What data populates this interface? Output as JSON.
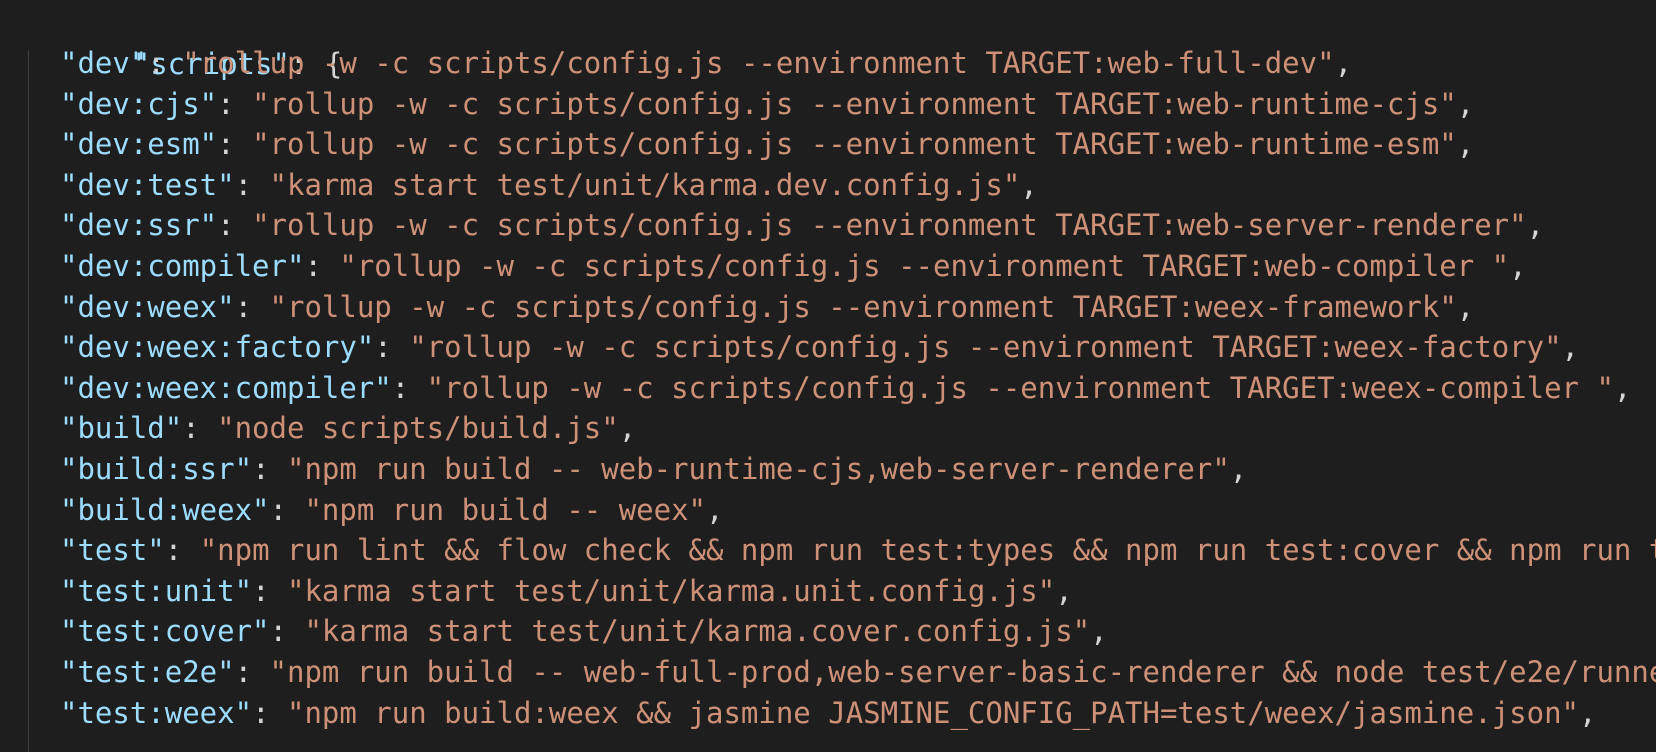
{
  "editor": {
    "language": "json",
    "colors": {
      "background": "#1e1e1e",
      "key": "#9cdcfe",
      "string": "#ce9178",
      "punctuation": "#d4d4d4"
    },
    "root_key": "\"scripts\"",
    "root_open": ": {",
    "entries": [
      {
        "key": "\"dev\"",
        "value": "\"rollup -w -c scripts/config.js --environment TARGET:web-full-dev\"",
        "trail": ","
      },
      {
        "key": "\"dev:cjs\"",
        "value": "\"rollup -w -c scripts/config.js --environment TARGET:web-runtime-cjs\"",
        "trail": ","
      },
      {
        "key": "\"dev:esm\"",
        "value": "\"rollup -w -c scripts/config.js --environment TARGET:web-runtime-esm\"",
        "trail": ","
      },
      {
        "key": "\"dev:test\"",
        "value": "\"karma start test/unit/karma.dev.config.js\"",
        "trail": ","
      },
      {
        "key": "\"dev:ssr\"",
        "value": "\"rollup -w -c scripts/config.js --environment TARGET:web-server-renderer\"",
        "trail": ","
      },
      {
        "key": "\"dev:compiler\"",
        "value": "\"rollup -w -c scripts/config.js --environment TARGET:web-compiler \"",
        "trail": ","
      },
      {
        "key": "\"dev:weex\"",
        "value": "\"rollup -w -c scripts/config.js --environment TARGET:weex-framework\"",
        "trail": ","
      },
      {
        "key": "\"dev:weex:factory\"",
        "value": "\"rollup -w -c scripts/config.js --environment TARGET:weex-factory\"",
        "trail": ","
      },
      {
        "key": "\"dev:weex:compiler\"",
        "value": "\"rollup -w -c scripts/config.js --environment TARGET:weex-compiler \"",
        "trail": ","
      },
      {
        "key": "\"build\"",
        "value": "\"node scripts/build.js\"",
        "trail": ","
      },
      {
        "key": "\"build:ssr\"",
        "value": "\"npm run build -- web-runtime-cjs,web-server-renderer\"",
        "trail": ","
      },
      {
        "key": "\"build:weex\"",
        "value": "\"npm run build -- weex\"",
        "trail": ","
      },
      {
        "key": "\"test\"",
        "value": "\"npm run lint && flow check && npm run test:types && npm run test:cover && npm run t",
        "trail": ""
      },
      {
        "key": "\"test:unit\"",
        "value": "\"karma start test/unit/karma.unit.config.js\"",
        "trail": ","
      },
      {
        "key": "\"test:cover\"",
        "value": "\"karma start test/unit/karma.cover.config.js\"",
        "trail": ","
      },
      {
        "key": "\"test:e2e\"",
        "value": "\"npm run build -- web-full-prod,web-server-basic-renderer && node test/e2e/runne",
        "trail": ""
      },
      {
        "key": "\"test:weex\"",
        "value": "\"npm run build:weex && jasmine JASMINE_CONFIG_PATH=test/weex/jasmine.json\"",
        "trail": ","
      }
    ]
  }
}
